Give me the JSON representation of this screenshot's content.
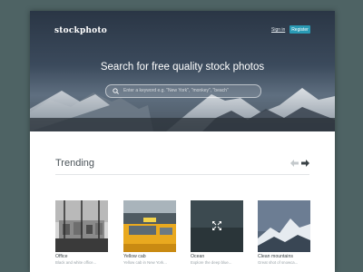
{
  "header": {
    "logo": "stockphoto",
    "sign_in": "Sign in",
    "register": "Register"
  },
  "hero": {
    "headline": "Search for free quality stock photos",
    "search_placeholder": "Enter a keyword e.g. \"New York\", \"monkey\", \"beach\""
  },
  "trending": {
    "title": "Trending",
    "cards": [
      {
        "title": "Office",
        "desc": "Black and white office..."
      },
      {
        "title": "Yellow cab",
        "desc": "Yellow cab in New York..."
      },
      {
        "title": "Ocean",
        "desc": "Explore the deep blue..."
      },
      {
        "title": "Clean mountains",
        "desc": "Great shot of snowca..."
      }
    ]
  },
  "colors": {
    "background": "#4e6364",
    "accent": "#2a9bb5"
  }
}
